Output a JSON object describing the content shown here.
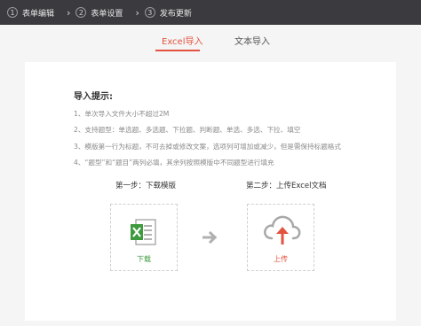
{
  "steps": [
    {
      "num": "1",
      "label": "表单编辑"
    },
    {
      "num": "2",
      "label": "表单设置"
    },
    {
      "num": "3",
      "label": "发布更新"
    }
  ],
  "tabs": [
    {
      "label": "Excel导入",
      "active": true
    },
    {
      "label": "文本导入",
      "active": false
    }
  ],
  "tips": {
    "title": "导入提示:",
    "items": [
      "1、单次导入文件大小不超过2M",
      "2、支持题型：单选题、多选题、下拉题、判断题、单选、多选、下拉、填空",
      "3、模版第一行为标题，不可去掉或修改文案，选项列可增加或减少，但是需保持标题格式",
      "4、“题型”和“题目”两列必填，其余列按照模版中不同题型进行填充"
    ]
  },
  "download": {
    "step_title": "第一步：下载模版",
    "label": "下载",
    "icon": "excel-file-icon",
    "color": "#3d9a3d"
  },
  "upload": {
    "step_title": "第二步：上传Excel文档",
    "label": "上传",
    "icon": "cloud-upload-icon",
    "color": "#e2543f"
  },
  "colors": {
    "accent": "#e2543f",
    "topbar": "#3b3b3f"
  }
}
